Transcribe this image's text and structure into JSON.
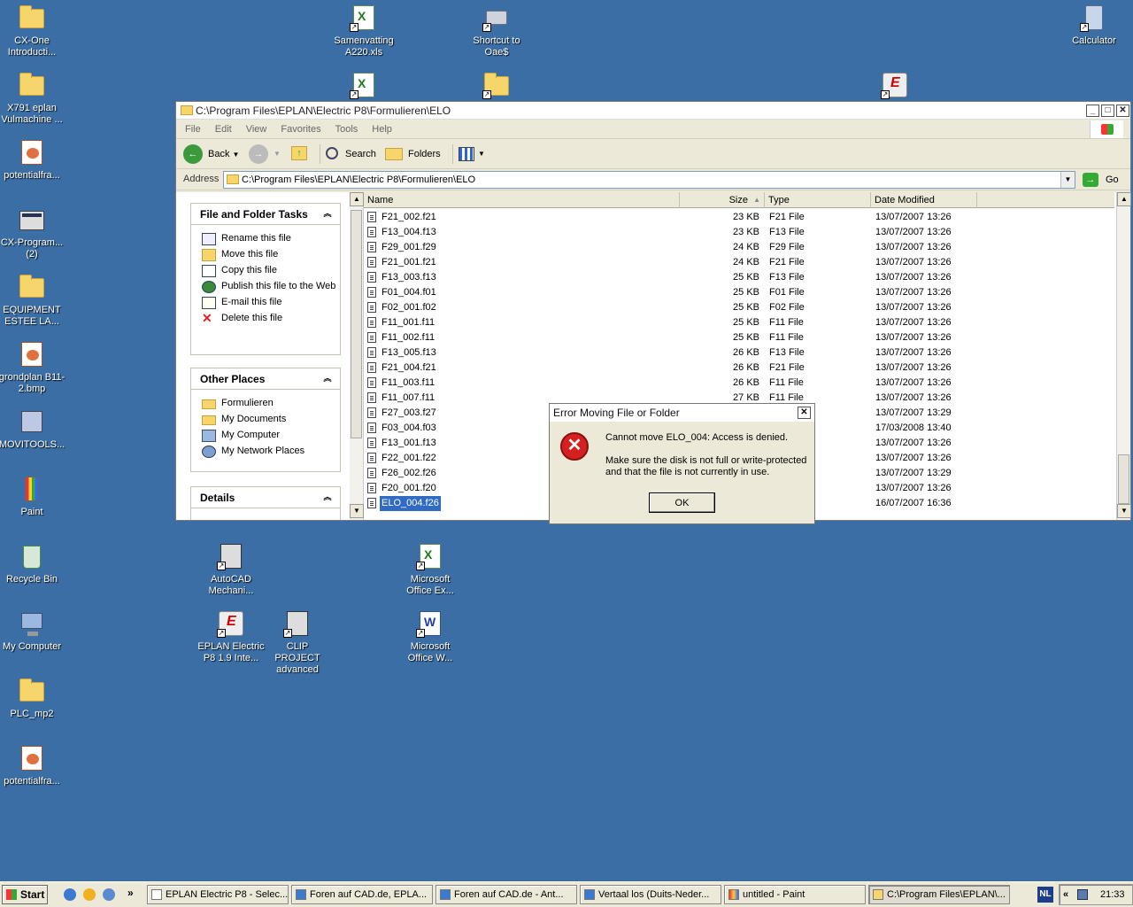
{
  "desktop": {
    "icons": [
      {
        "label": "CX-One Introducti...",
        "icon": "folder-icon"
      },
      {
        "label": "X791 eplan Vulmachine ...",
        "icon": "folder-icon"
      },
      {
        "label": "potentialfra...",
        "icon": "image-file-icon"
      },
      {
        "label": "CX-Program... (2)",
        "icon": "program-icon"
      },
      {
        "label": "EQUIPMENT ESTEE LA...",
        "icon": "folder-icon"
      },
      {
        "label": "grondplan B11-2.bmp",
        "icon": "bitmap-icon"
      },
      {
        "label": "MOVITOOLS...",
        "icon": "program-icon"
      },
      {
        "label": "Paint",
        "icon": "paint-icon"
      },
      {
        "label": "Recycle Bin",
        "icon": "recycle-bin-icon"
      },
      {
        "label": "My Computer",
        "icon": "computer-icon"
      },
      {
        "label": "PLC_mp2",
        "icon": "folder-icon"
      },
      {
        "label": "potentialfra...",
        "icon": "image-file-icon"
      },
      {
        "label": "Samenvatting A220.xls",
        "icon": "excel-file-icon"
      },
      {
        "label": "Shortcut to Oae$",
        "icon": "network-drive-icon"
      },
      {
        "label": "Calculator",
        "icon": "calculator-icon"
      },
      {
        "label": "AutoCAD Mechani...",
        "icon": "autocad-icon"
      },
      {
        "label": "Microsoft Office Ex...",
        "icon": "excel-icon"
      },
      {
        "label": "EPLAN Electric P8 1.9 Inte...",
        "icon": "eplan-icon"
      },
      {
        "label": "CLIP PROJECT advanced",
        "icon": "clip-project-icon"
      },
      {
        "label": "Microsoft Office W...",
        "icon": "word-icon"
      }
    ]
  },
  "explorer": {
    "title": "C:\\Program Files\\EPLAN\\Electric P8\\Formulieren\\ELO",
    "menu": [
      "File",
      "Edit",
      "View",
      "Favorites",
      "Tools",
      "Help"
    ],
    "toolbar": {
      "back": "Back",
      "search": "Search",
      "folders": "Folders"
    },
    "address_label": "Address",
    "address_value": "C:\\Program Files\\EPLAN\\Electric P8\\Formulieren\\ELO",
    "go_label": "Go",
    "file_tasks": {
      "title": "File and Folder Tasks",
      "items": [
        "Rename this file",
        "Move this file",
        "Copy this file",
        "Publish this file to the Web",
        "E-mail this file",
        "Delete this file"
      ]
    },
    "other_places": {
      "title": "Other Places",
      "items": [
        "Formulieren",
        "My Documents",
        "My Computer",
        "My Network Places"
      ]
    },
    "details": {
      "title": "Details"
    },
    "columns": [
      "Name",
      "Size",
      "Type",
      "Date Modified"
    ],
    "files": [
      {
        "name": "F21_002.f21",
        "size": "23 KB",
        "type": "F21 File",
        "date": "13/07/2007 13:26"
      },
      {
        "name": "F13_004.f13",
        "size": "23 KB",
        "type": "F13 File",
        "date": "13/07/2007 13:26"
      },
      {
        "name": "F29_001.f29",
        "size": "24 KB",
        "type": "F29 File",
        "date": "13/07/2007 13:26"
      },
      {
        "name": "F21_001.f21",
        "size": "24 KB",
        "type": "F21 File",
        "date": "13/07/2007 13:26"
      },
      {
        "name": "F13_003.f13",
        "size": "25 KB",
        "type": "F13 File",
        "date": "13/07/2007 13:26"
      },
      {
        "name": "F01_004.f01",
        "size": "25 KB",
        "type": "F01 File",
        "date": "13/07/2007 13:26"
      },
      {
        "name": "F02_001.f02",
        "size": "25 KB",
        "type": "F02 File",
        "date": "13/07/2007 13:26"
      },
      {
        "name": "F11_001.f11",
        "size": "25 KB",
        "type": "F11 File",
        "date": "13/07/2007 13:26"
      },
      {
        "name": "F11_002.f11",
        "size": "25 KB",
        "type": "F11 File",
        "date": "13/07/2007 13:26"
      },
      {
        "name": "F13_005.f13",
        "size": "26 KB",
        "type": "F13 File",
        "date": "13/07/2007 13:26"
      },
      {
        "name": "F21_004.f21",
        "size": "26 KB",
        "type": "F21 File",
        "date": "13/07/2007 13:26"
      },
      {
        "name": "F11_003.f11",
        "size": "26 KB",
        "type": "F11 File",
        "date": "13/07/2007 13:26"
      },
      {
        "name": "F11_007.f11",
        "size": "27 KB",
        "type": "F11 File",
        "date": "13/07/2007 13:26"
      },
      {
        "name": "F27_003.f27",
        "size": "",
        "type": "",
        "date": "13/07/2007 13:29"
      },
      {
        "name": "F03_004.f03",
        "size": "",
        "type": "",
        "date": "17/03/2008 13:40"
      },
      {
        "name": "F13_001.f13",
        "size": "",
        "type": "",
        "date": "13/07/2007 13:26"
      },
      {
        "name": "F22_001.f22",
        "size": "",
        "type": "",
        "date": "13/07/2007 13:26"
      },
      {
        "name": "F26_002.f26",
        "size": "",
        "type": "",
        "date": "13/07/2007 13:29"
      },
      {
        "name": "F20_001.f20",
        "size": "",
        "type": "",
        "date": "13/07/2007 13:26"
      },
      {
        "name": "ELO_004.f26",
        "size": "",
        "type": "",
        "date": "16/07/2007 16:36",
        "selected": true
      }
    ]
  },
  "dialog": {
    "title": "Error Moving File or Folder",
    "message": "Cannot move ELO_004: Access is denied.",
    "detail": "Make sure the disk is not full or write-protected and that the file is not currently in use.",
    "ok": "OK"
  },
  "taskbar": {
    "start": "Start",
    "chevron": "»",
    "buttons": [
      {
        "label": "EPLAN Electric P8 - Selec...",
        "active": false
      },
      {
        "label": "Foren auf CAD.de, EPLA...",
        "active": false
      },
      {
        "label": "Foren auf CAD.de - Ant...",
        "active": false
      },
      {
        "label": "Vertaal los (Duits-Neder...",
        "active": false
      },
      {
        "label": "untitled - Paint",
        "active": false
      },
      {
        "label": "C:\\Program Files\\EPLAN\\...",
        "active": true
      }
    ],
    "language": "NL",
    "tray_chevron": "«",
    "clock": "21:33"
  }
}
